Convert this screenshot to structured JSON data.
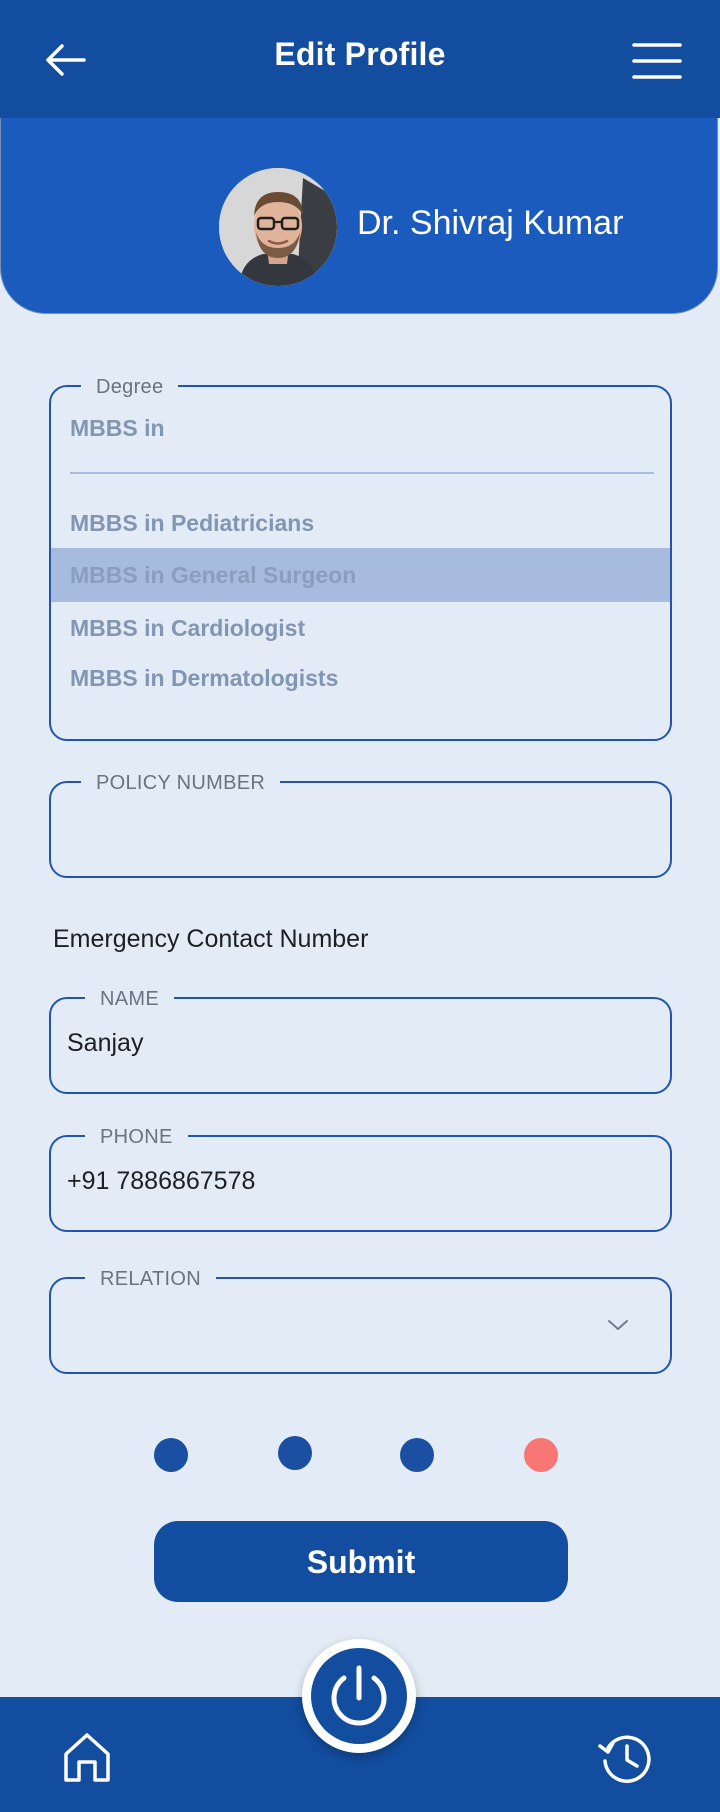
{
  "header": {
    "title": "Edit Profile",
    "back_icon": "arrow-left-icon",
    "menu_icon": "hamburger-menu-icon"
  },
  "profile": {
    "name": "Dr. Shivraj Kumar"
  },
  "degree": {
    "legend": "Degree",
    "value": "MBBS in",
    "options": [
      "MBBS in Pediatricians",
      "MBBS in General Surgeon",
      "MBBS in Cardiologist",
      "MBBS in Dermatologists"
    ],
    "selected": "MBBS in General Surgeon"
  },
  "policy": {
    "legend": "POLICY NUMBER",
    "value": ""
  },
  "emergency": {
    "heading": "Emergency Contact Number",
    "name_legend": "NAME",
    "name_value": "Sanjay",
    "phone_legend": "PHONE",
    "phone_value": "+91 7886867578",
    "relation_legend": "RELATION",
    "relation_value": ""
  },
  "pagination": {
    "total": 4,
    "active_index": 3
  },
  "actions": {
    "submit_label": "Submit"
  },
  "bottom_nav": {
    "home_icon": "home-icon",
    "power_icon": "power-icon",
    "history_icon": "history-icon"
  },
  "colors": {
    "primary": "#124d9f",
    "profile_bg": "#1a5bbd",
    "page_bg": "#e3ecf6",
    "field_border": "#1f56b0",
    "active_dot": "#f87673"
  }
}
